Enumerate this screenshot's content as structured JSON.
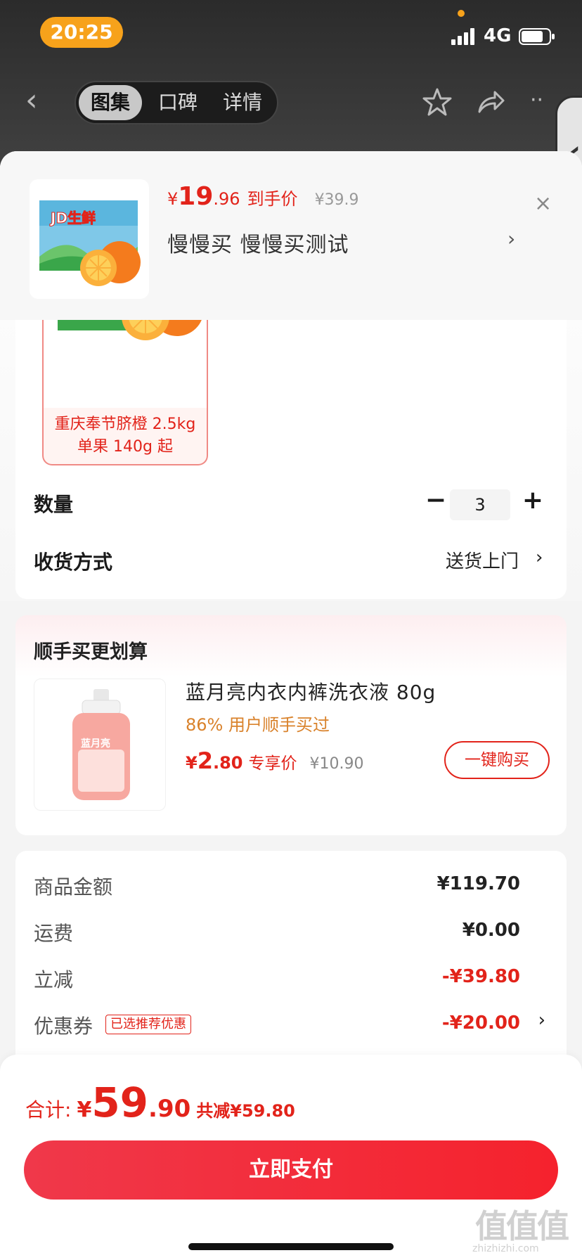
{
  "status_bar": {
    "time": "20:25",
    "network": "4G"
  },
  "nav": {
    "tabs": [
      "图集",
      "口碑",
      "详情"
    ]
  },
  "product": {
    "price_symbol": "¥",
    "price_int": "19",
    "price_dec": ".96",
    "price_tag": "到手价",
    "original_price": "¥39.9",
    "title": "慢慢买  慢慢买测试",
    "thumb_brand": "JD生鲜"
  },
  "spec": {
    "option_line1": "重庆奉节脐橙 2.5kg",
    "option_line2": "单果 140g 起",
    "qty_label": "数量",
    "qty_minus": "−",
    "qty_value": "3",
    "qty_plus": "+",
    "delivery_label": "收货方式",
    "delivery_value": "送货上门"
  },
  "addon": {
    "title": "顺手买更划算",
    "name": "蓝月亮内衣内裤洗衣液 80g",
    "hint": "86% 用户顺手买过",
    "price_symbol": "¥",
    "price_int": "2",
    "price_dec": ".80",
    "price_tag": "专享价",
    "original_price": "¥10.90",
    "buy_label": "一键购买",
    "brand": "蓝月亮"
  },
  "summary": {
    "rows": [
      {
        "label": "商品金额",
        "value": "¥119.70"
      },
      {
        "label": "运费",
        "value": "¥0.00"
      },
      {
        "label": "立减",
        "value": "-¥39.80"
      },
      {
        "label": "优惠券",
        "value": "-¥20.00"
      }
    ],
    "coupon_badge": "已选推荐优惠"
  },
  "footer": {
    "total_label": "合计:",
    "total_symbol": "¥",
    "total_int": "59",
    "total_dec": ".90",
    "total_saving": "共减¥59.80",
    "pay_label": "立即支付",
    "watermark": "值值值",
    "watermark_sub": "zhizhizhi.com"
  },
  "colors": {
    "accent": "#e2231a",
    "time_pill": "#f7a21b",
    "hint": "#d9822b"
  }
}
